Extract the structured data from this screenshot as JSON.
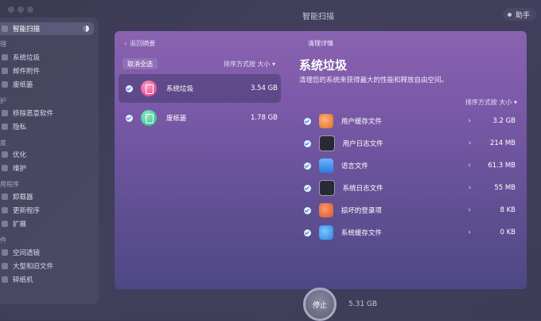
{
  "app": {
    "title": "智能扫描",
    "assistant_label": "助手"
  },
  "sidebar": {
    "active": "智能扫描",
    "sections": [
      {
        "header": "理",
        "items": [
          "系统垃圾",
          "邮件附件",
          "废纸篓"
        ]
      },
      {
        "header": "护",
        "items": [
          "移除恶意软件",
          "隐私"
        ]
      },
      {
        "header": "度",
        "items": [
          "优化",
          "维护"
        ]
      },
      {
        "header": "用程序",
        "items": [
          "卸载器",
          "更新程序",
          "扩展"
        ]
      },
      {
        "header": "件",
        "items": [
          "空间透镜",
          "大型和旧文件",
          "碎纸机"
        ]
      }
    ]
  },
  "panel": {
    "back_label": "返回摘要",
    "title": "清理详情",
    "deselect_all": "取消全选",
    "sort_label": "排序方式按 大小 ▾",
    "list": [
      {
        "name": "系统垃圾",
        "size": "3.54 GB",
        "selected": true
      },
      {
        "name": "废纸篓",
        "size": "1.78 GB",
        "selected": false
      }
    ],
    "detail": {
      "title": "系统垃圾",
      "description": "清理您的系统来获得最大的性能和释放自由空间。",
      "sort_label": "排序方式按 大小 ▾",
      "rows": [
        {
          "name": "用户缓存文件",
          "size": "3.2 GB",
          "icon": "user-cache-icon"
        },
        {
          "name": "用户日志文件",
          "size": "214 MB",
          "icon": "user-log-icon"
        },
        {
          "name": "语言文件",
          "size": "61.3 MB",
          "icon": "language-files-icon"
        },
        {
          "name": "系统日志文件",
          "size": "55 MB",
          "icon": "system-log-icon"
        },
        {
          "name": "损坏的登录项",
          "size": "8 KB",
          "icon": "broken-login-icon"
        },
        {
          "name": "系统缓存文件",
          "size": "0 KB",
          "icon": "system-cache-icon"
        }
      ]
    }
  },
  "footer": {
    "stop_label": "停止",
    "total_size": "5.31 GB"
  }
}
